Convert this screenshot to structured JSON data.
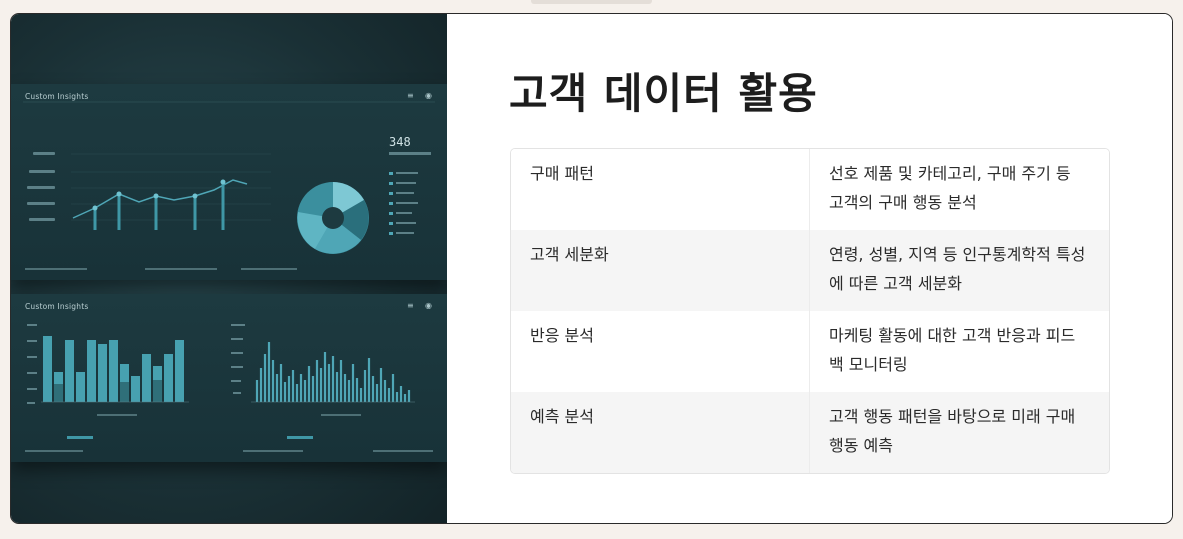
{
  "heading": "고객 데이터 활용",
  "rows": [
    {
      "label": "구매 패턴",
      "desc": "선호 제품 및 카테고리, 구매 주기 등 고객의 구매 행동 분석"
    },
    {
      "label": "고객 세분화",
      "desc": "연령, 성별, 지역 등 인구통계학적 특성에 따른 고객 세분화"
    },
    {
      "label": "반응 분석",
      "desc": "마케팅 활동에 대한 고객 반응과 피드백 모니터링"
    },
    {
      "label": "예측 분석",
      "desc": "고객 행동 패턴을 바탕으로 미래 구매 행동 예측"
    }
  ],
  "image": {
    "top_panel_title": "Custom Insights",
    "bottom_panel_title": "Custom Insights",
    "metric": "348",
    "menu_icon": "menu-icon",
    "settings_icon": "gear-icon",
    "accent": "#4fa6b6"
  }
}
